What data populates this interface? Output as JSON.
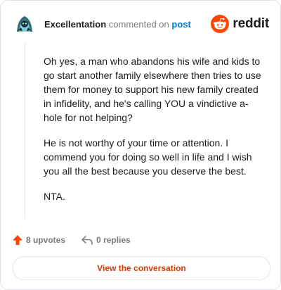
{
  "comment": {
    "author": "Excellentation",
    "action_text": "commented on",
    "target_link": "post",
    "paragraphs": [
      "Oh yes, a man who abandons his wife and kids to go start another family elsewhere then tries to use them for money to support his new family created in infidelity, and he's calling YOU a vindictive a-hole for not helping?",
      "He is not worthy of your time or attention. I commend you for doing so well in life and I wish you all the best because you deserve the best.",
      "NTA."
    ]
  },
  "brand": {
    "name": "reddit",
    "icon": "reddit-snoo-icon",
    "color": "#ff4500"
  },
  "actions": {
    "upvotes_label": "8 upvotes",
    "upvote_icon": "upvote-arrow-icon",
    "upvote_color": "#ff4500",
    "replies_label": "0 replies",
    "reply_icon": "reply-arrow-icon"
  },
  "footer": {
    "button_label": "View the conversation",
    "button_color": "#d93900"
  }
}
